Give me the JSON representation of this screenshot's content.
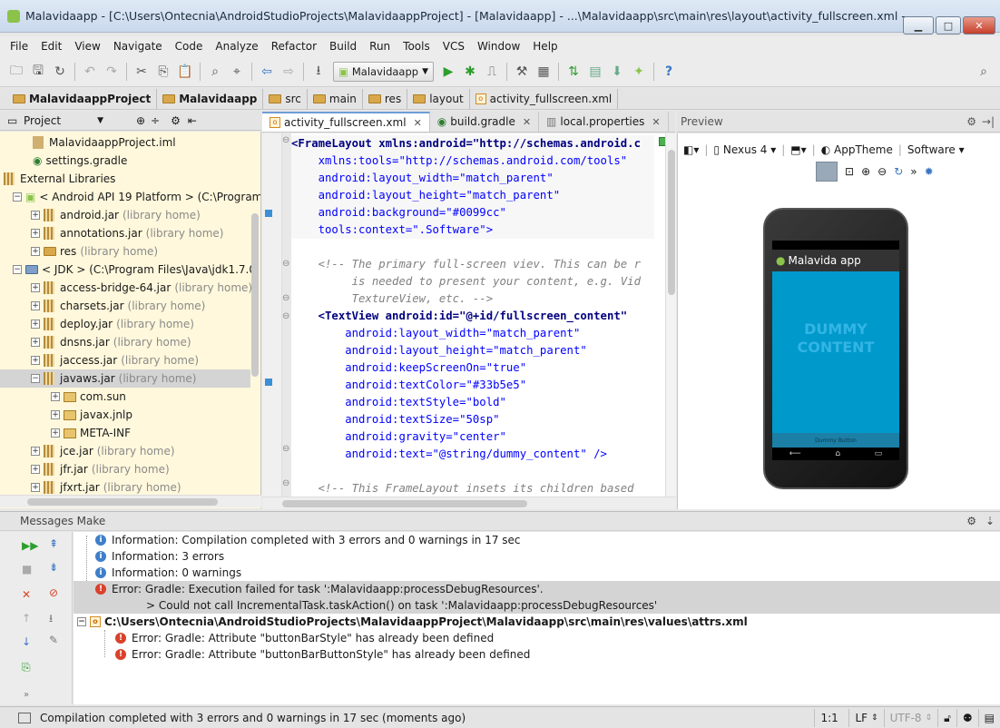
{
  "window": {
    "title": "Malavidaapp - [C:\\Users\\Ontecnia\\AndroidStudioProjects\\MalavidaappProject] - [Malavidaapp] - ...\\Malavidaapp\\src\\main\\res\\layout\\activity_fullscreen.xml - An..."
  },
  "menu": [
    "File",
    "Edit",
    "View",
    "Navigate",
    "Code",
    "Analyze",
    "Refactor",
    "Build",
    "Run",
    "Tools",
    "VCS",
    "Window",
    "Help"
  ],
  "toolbar": {
    "run_config": "Malavidaapp"
  },
  "breadcrumbs": [
    "MalavidaappProject",
    "Malavidaapp",
    "src",
    "main",
    "res",
    "layout",
    "activity_fullscreen.xml"
  ],
  "project_panel": {
    "title": "Project",
    "items": [
      {
        "label": "MalavidaappProject.iml",
        "muted": ""
      },
      {
        "label": "settings.gradle",
        "muted": ""
      },
      {
        "label": "External Libraries",
        "muted": ""
      },
      {
        "label": "< Android API 19 Platform > (C:\\Program",
        "muted": ""
      },
      {
        "label": "android.jar",
        "muted": "(library home)"
      },
      {
        "label": "annotations.jar",
        "muted": "(library home)"
      },
      {
        "label": "res",
        "muted": "(library home)"
      },
      {
        "label": "< JDK > (C:\\Program Files\\Java\\jdk1.7.0",
        "muted": ""
      },
      {
        "label": "access-bridge-64.jar",
        "muted": "(library home)"
      },
      {
        "label": "charsets.jar",
        "muted": "(library home)"
      },
      {
        "label": "deploy.jar",
        "muted": "(library home)"
      },
      {
        "label": "dnsns.jar",
        "muted": "(library home)"
      },
      {
        "label": "jaccess.jar",
        "muted": "(library home)"
      },
      {
        "label": "javaws.jar",
        "muted": "(library home)"
      },
      {
        "label": "com.sun",
        "muted": ""
      },
      {
        "label": "javax.jnlp",
        "muted": ""
      },
      {
        "label": "META-INF",
        "muted": ""
      },
      {
        "label": "jce.jar",
        "muted": "(library home)"
      },
      {
        "label": "jfr.jar",
        "muted": "(library home)"
      },
      {
        "label": "jfxrt.jar",
        "muted": "(library home)"
      }
    ]
  },
  "editor_tabs": [
    {
      "label": "activity_fullscreen.xml"
    },
    {
      "label": "build.gradle"
    },
    {
      "label": "local.properties"
    }
  ],
  "code": [
    "<FrameLayout xmlns:android=\"http://schemas.android.c",
    "    xmlns:tools=\"http://schemas.android.com/tools\"",
    "    android:layout_width=\"match_parent\"",
    "    android:layout_height=\"match_parent\"",
    "    android:background=\"#0099cc\"",
    "    tools:context=\".Software\">",
    "",
    "    <!-- The primary full-screen viev. This can be r",
    "         is needed to present your content, e.g. Vid",
    "         TextureView, etc. -->",
    "    <TextView android:id=\"@+id/fullscreen_content\"",
    "        android:layout_width=\"match_parent\"",
    "        android:layout_height=\"match_parent\"",
    "        android:keepScreenOn=\"true\"",
    "        android:textColor=\"#33b5e5\"",
    "        android:textStyle=\"bold\"",
    "        android:textSize=\"50sp\"",
    "        android:gravity=\"center\"",
    "        android:text=\"@string/dummy_content\" />",
    "",
    "    <!-- This FrameLayout insets its children based"
  ],
  "preview": {
    "title": "Preview",
    "device": "Nexus 4",
    "theme": "AppTheme",
    "activity": "Software",
    "app_title": "Malavida app",
    "content": "DUMMY CONTENT",
    "button": "Dummy Button",
    "screen_color": "#0099cc"
  },
  "messages": {
    "title": "Messages Make",
    "rows": [
      {
        "type": "info",
        "text": "Information: Compilation completed with 3 errors and 0 warnings in 17 sec"
      },
      {
        "type": "info",
        "text": "Information: 3 errors"
      },
      {
        "type": "info",
        "text": "Information: 0 warnings"
      },
      {
        "type": "error",
        "text": "Error: Gradle: Execution failed for task ':Malavidaapp:processDebugResources'."
      },
      {
        "type": "cont",
        "text": "> Could not call IncrementalTask.taskAction() on task ':Malavidaapp:processDebugResources'"
      },
      {
        "type": "file",
        "text": "C:\\Users\\Ontecnia\\AndroidStudioProjects\\MalavidaappProject\\Malavidaapp\\src\\main\\res\\values\\attrs.xml"
      },
      {
        "type": "error",
        "text": "Error: Gradle: Attribute \"buttonBarStyle\" has already been defined"
      },
      {
        "type": "error",
        "text": "Error: Gradle: Attribute \"buttonBarButtonStyle\" has already been defined"
      }
    ]
  },
  "status": {
    "text": "Compilation completed with 3 errors and 0 warnings in 17 sec (moments ago)",
    "position": "1:1",
    "line_sep": "LF",
    "encoding": "UTF-8"
  }
}
